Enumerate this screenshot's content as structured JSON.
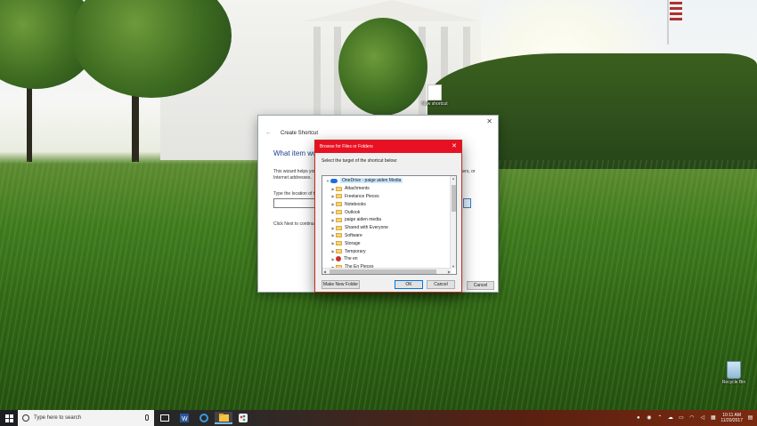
{
  "desktop": {
    "icons": [
      {
        "label": "New shortcut"
      },
      {
        "label": "Recycle Bin"
      }
    ]
  },
  "wizard": {
    "title": "Create Shortcut",
    "heading": "What item would you like to create a shortcut for?",
    "description_start": "This wizard helps you create shortcuts to local or network programs, files, folders, computers, or",
    "description_end": "ters, or",
    "description_line2": "Internet addresses.",
    "location_label": "Type the location of the item:",
    "next_hint": "Click Next to continue.",
    "cancel_label": "Cancel"
  },
  "browse_dialog": {
    "title": "Browse for Files or Folders",
    "instruction": "Select the target of the shortcut below:",
    "root": "OneDrive - paige aiden Media",
    "items": [
      {
        "label": "Attachments",
        "icon": "folder"
      },
      {
        "label": "Freelance Pieces",
        "icon": "folder"
      },
      {
        "label": "Notebooks",
        "icon": "folder"
      },
      {
        "label": "Outlook",
        "icon": "folder"
      },
      {
        "label": "paige aiden media",
        "icon": "folder"
      },
      {
        "label": "Shared with Everyone",
        "icon": "folder"
      },
      {
        "label": "Software",
        "icon": "folder"
      },
      {
        "label": "Storage",
        "icon": "folder"
      },
      {
        "label": "Temporary",
        "icon": "folder"
      },
      {
        "label": "The en",
        "icon": "person"
      },
      {
        "label": "The En Pieces",
        "icon": "folder"
      }
    ],
    "make_new_folder_label": "Make New Folder",
    "ok_label": "OK",
    "cancel_label": "Cancel",
    "accent_color": "#e81123"
  },
  "taskbar": {
    "search_placeholder": "Type here to search",
    "apps": [
      "task-view",
      "word",
      "edge",
      "file-explorer",
      "paint"
    ],
    "active_app": "file-explorer",
    "clock": {
      "time": "10:11 AM",
      "date": "11/20/2017"
    }
  }
}
